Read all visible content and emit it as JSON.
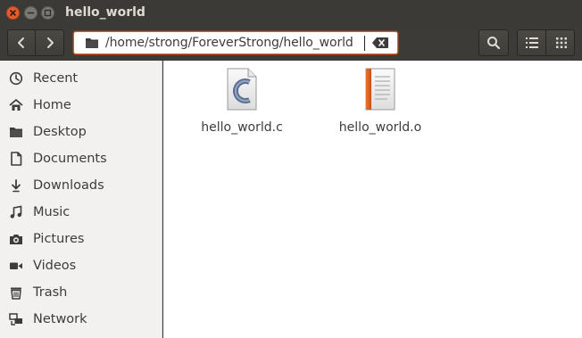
{
  "window": {
    "title": "hello_world",
    "controls": [
      "close-icon",
      "minimize-icon",
      "maximize-icon"
    ]
  },
  "toolbar": {
    "back_icon": "chevron-left-icon",
    "forward_icon": "chevron-right-icon",
    "path": "/home/strong/ForeverStrong/hello_world",
    "clear_icon": "backspace-icon",
    "search_icon": "search-icon",
    "view_list_icon": "list-view-icon",
    "view_grid_icon": "grid-view-icon"
  },
  "sidebar": {
    "items": [
      {
        "label": "Recent",
        "icon": "clock-icon"
      },
      {
        "label": "Home",
        "icon": "home-icon"
      },
      {
        "label": "Desktop",
        "icon": "folder-icon"
      },
      {
        "label": "Documents",
        "icon": "document-icon"
      },
      {
        "label": "Downloads",
        "icon": "download-icon"
      },
      {
        "label": "Music",
        "icon": "music-icon"
      },
      {
        "label": "Pictures",
        "icon": "camera-icon"
      },
      {
        "label": "Videos",
        "icon": "video-icon"
      },
      {
        "label": "Trash",
        "icon": "trash-icon"
      },
      {
        "label": "Network",
        "icon": "network-icon"
      }
    ]
  },
  "files": [
    {
      "name": "hello_world.c",
      "icon": "c-source-file-icon"
    },
    {
      "name": "hello_world.o",
      "icon": "object-file-icon"
    }
  ],
  "colors": {
    "accent": "#e95420",
    "titlebar": "#3b3a36",
    "sidebar_bg": "#f2f1f0"
  }
}
